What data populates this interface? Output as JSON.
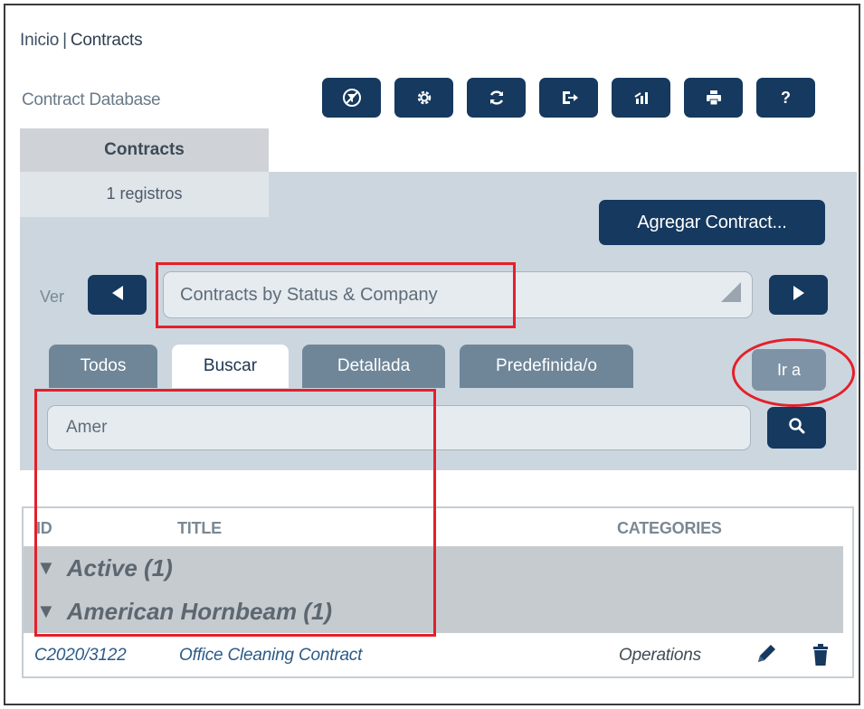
{
  "breadcrumb": {
    "home": "Inicio",
    "separator": "|",
    "current": "Contracts"
  },
  "database_title": "Contract Database",
  "toolbar": {
    "buttons": [
      {
        "name": "no-filter-icon"
      },
      {
        "name": "settings-icon"
      },
      {
        "name": "refresh-icon"
      },
      {
        "name": "export-icon"
      },
      {
        "name": "report-icon"
      },
      {
        "name": "print-icon"
      },
      {
        "name": "help-icon",
        "label": "?"
      }
    ]
  },
  "table_tab": {
    "label": "Contracts",
    "count": "1 registros"
  },
  "add_button": "Agregar Contract...",
  "view": {
    "label": "Ver",
    "selected": "Contracts by Status & Company"
  },
  "filter_tabs": {
    "all": "Todos",
    "search": "Buscar",
    "detailed": "Detallada",
    "predefined": "Predefinida/o",
    "goto": "Ir a"
  },
  "search": {
    "value": "Amer"
  },
  "results": {
    "columns": {
      "id": "ID",
      "title": "TITLE",
      "categories": "CATEGORIES"
    },
    "groups": [
      {
        "label": "Active (1)"
      },
      {
        "label": "American Hornbeam (1)"
      }
    ],
    "rows": [
      {
        "id": "C2020/3122",
        "title": "Office Cleaning Contract",
        "categories": "Operations"
      }
    ]
  },
  "colors": {
    "primary": "#15395f",
    "tab_inactive": "#6f8699",
    "panel": "#ccd6df",
    "annotation": "#e3202a"
  }
}
